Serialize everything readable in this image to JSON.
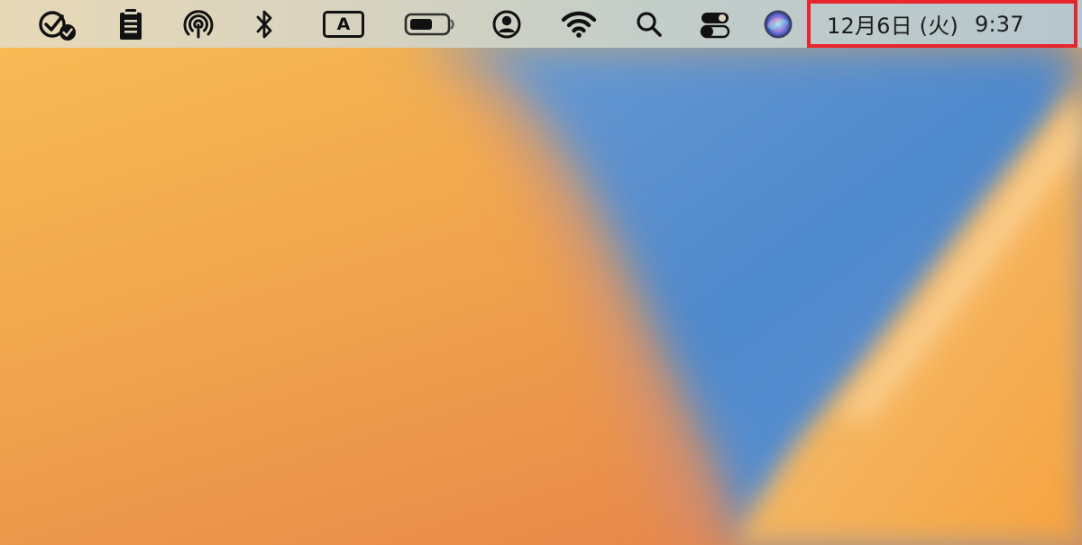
{
  "menubar": {
    "icons": [
      {
        "name": "reminder-check-icon"
      },
      {
        "name": "clipboard-icon"
      },
      {
        "name": "airdrop-icon"
      },
      {
        "name": "bluetooth-icon"
      },
      {
        "name": "input-source-icon",
        "label": "A"
      },
      {
        "name": "battery-icon"
      },
      {
        "name": "user-account-icon"
      },
      {
        "name": "wifi-icon"
      },
      {
        "name": "spotlight-search-icon"
      },
      {
        "name": "control-center-icon"
      },
      {
        "name": "siri-icon"
      }
    ],
    "clock": {
      "date": "12月6日 (火)",
      "time": "9:37"
    },
    "highlight_color": "#e8242c"
  },
  "wallpaper": {
    "colors": [
      "#f7b94f",
      "#e8964f",
      "#5b8fd0",
      "#4e86c9",
      "#f3b25a"
    ]
  }
}
